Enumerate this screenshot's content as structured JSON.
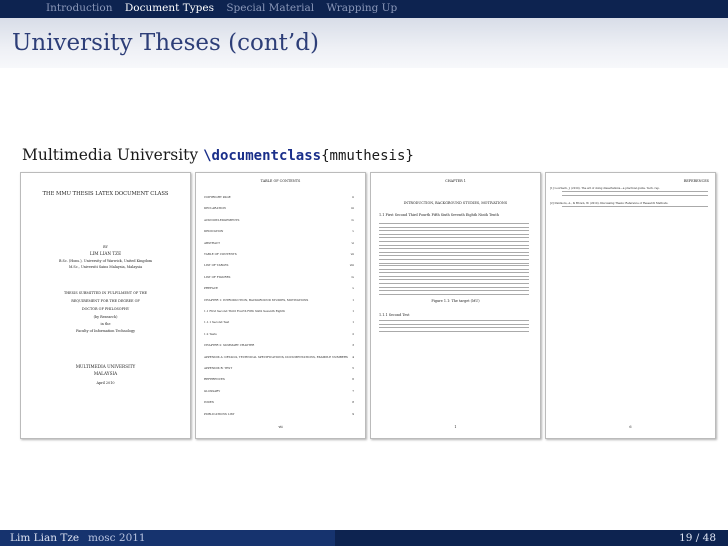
{
  "nav": {
    "items": [
      {
        "label": "Introduction",
        "active": false
      },
      {
        "label": "Document Types",
        "active": true
      },
      {
        "label": "Special Material",
        "active": false
      },
      {
        "label": "Wrapping Up",
        "active": false
      }
    ]
  },
  "frame": {
    "title": "University Theses (cont’d)",
    "heading_prefix": "Multimedia University ",
    "heading_cmd": "\\documentclass",
    "heading_arg": "{mmuthesis}"
  },
  "page1": {
    "title": "THE MMU THESIS LATEX DOCUMENT CLASS",
    "by": "BY",
    "author": "LIM LIAN TZE",
    "degree1": "B.Sc. (Hons.), University of Warwick, United Kingdom",
    "degree2": "M.Sc., Universiti Sains Malaysia, Malaysia",
    "thesis1": "THESIS SUBMITTED IN FULFILMENT OF THE",
    "thesis2": "REQUIREMENT FOR THE DEGREE OF",
    "thesis3": "DOCTOR OF PHILOSOPHY",
    "in": "(by Research)",
    "in2": "in the",
    "faculty": "Faculty of Information Technology",
    "univ1": "MULTIMEDIA UNIVERSITY",
    "univ2": "MALAYSIA",
    "date": "April 2010"
  },
  "page2": {
    "heading": "TABLE OF CONTENTS",
    "rows": [
      {
        "label": "COPYRIGHT PAGE",
        "num": "ii"
      },
      {
        "label": "DECLARATION",
        "num": "iii"
      },
      {
        "label": "ACKNOWLEDGEMENTS",
        "num": "iv"
      },
      {
        "label": "DEDICATION",
        "num": "v"
      },
      {
        "label": "ABSTRACT",
        "num": "vi"
      },
      {
        "label": "TABLE OF CONTENTS",
        "num": "vii"
      },
      {
        "label": "LIST OF TABLES",
        "num": "viii"
      },
      {
        "label": "LIST OF FIGURES",
        "num": "ix"
      },
      {
        "label": "PREFACE",
        "num": "x"
      },
      {
        "label": "CHAPTER 1: INTRODUCTION, BACKGROUND STUDIES, MOTIVATIONS",
        "num": "1"
      },
      {
        "label": "1.1  First Second Third Fourth Fifth Sixth Seventh Eighth",
        "num": "1"
      },
      {
        "label": "1.1.1  Second Test",
        "num": "1"
      },
      {
        "label": "1.2  Tests",
        "num": "2"
      },
      {
        "label": "CHAPTER 2: SUMMARY CHAPTER",
        "num": "3"
      },
      {
        "label": "APPENDIX A: DETAILS, TECHNICAL SPECIFICATIONS, DOCUMENTATIONS, EXAMPLE NUMBERS",
        "num": "4"
      },
      {
        "label": "APPENDIX B: TEST",
        "num": "5"
      },
      {
        "label": "REFERENCES",
        "num": "6"
      },
      {
        "label": "GLOSSARY",
        "num": "7"
      },
      {
        "label": "INDEX",
        "num": "8"
      },
      {
        "label": "PUBLICATIONS LIST",
        "num": "9"
      }
    ],
    "footer": "vii"
  },
  "page3": {
    "chapter": "CHAPTER 1",
    "chapter_title": "INTRODUCTION, BACKGROUND STUDIES, MOTIVATIONS",
    "section": "1.1  First Second Third Fourth Fifth Sixth Seventh Eighth Ninth Tenth",
    "figure": "Figure 1.1: The target (MU)",
    "subsection": "1.1.1  Second Test",
    "footer": "1"
  },
  "page4": {
    "heading": "REFERENCES",
    "ref1": "[1]  Loorbach, J. (2010). The art of doing dissertations—a practical guide. Tech. rep.",
    "ref2": "[2]  Dunmore, A., & Brown, W. (2010). Discussing Thesis: Reference of Research Methods.",
    "footer": "6"
  },
  "footer": {
    "author": "Lim Lian Tze",
    "event": "mosc 2011",
    "page": "19 / 48"
  }
}
